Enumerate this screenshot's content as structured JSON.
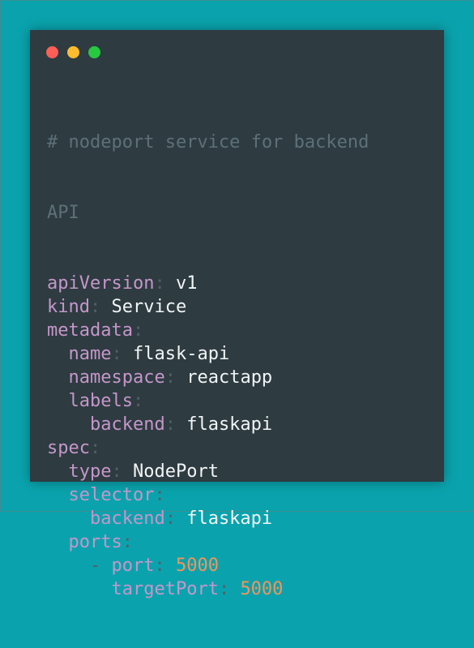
{
  "colors": {
    "background": "#0aa3ad",
    "window": "#2e3b41",
    "close": "#ff5f57",
    "minimize": "#febc2e",
    "maximize": "#28c840",
    "comment": "#5d7078",
    "key": "#c497c9",
    "punctuation": "#4f6068",
    "value": "#f2f5f6",
    "number": "#f0955b"
  },
  "window": {
    "controls": [
      "close-dot",
      "minimize-dot",
      "maximize-dot"
    ]
  },
  "code": {
    "comment_line1": "# nodeport service for backend",
    "comment_line2": "API",
    "lines": [
      {
        "indent": "",
        "key": "apiVersion",
        "value": "v1",
        "type": "text"
      },
      {
        "indent": "",
        "key": "kind",
        "value": "Service",
        "type": "text"
      },
      {
        "indent": "",
        "key": "metadata",
        "value": "",
        "type": "text"
      },
      {
        "indent": "  ",
        "key": "name",
        "value": "flask-api",
        "type": "text"
      },
      {
        "indent": "  ",
        "key": "namespace",
        "value": "reactapp",
        "type": "text"
      },
      {
        "indent": "  ",
        "key": "labels",
        "value": "",
        "type": "text"
      },
      {
        "indent": "    ",
        "key": "backend",
        "value": "flaskapi",
        "type": "text"
      },
      {
        "indent": "",
        "key": "spec",
        "value": "",
        "type": "text"
      },
      {
        "indent": "  ",
        "key": "type",
        "value": "NodePort",
        "type": "text"
      },
      {
        "indent": "  ",
        "key": "selector",
        "value": "",
        "type": "text"
      },
      {
        "indent": "    ",
        "key": "backend",
        "value": "flaskapi",
        "type": "text"
      },
      {
        "indent": "  ",
        "key": "ports",
        "value": "",
        "type": "text"
      },
      {
        "indent": "    ",
        "dash": "- ",
        "key": "port",
        "value": "5000",
        "type": "number"
      },
      {
        "indent": "      ",
        "key": "targetPort",
        "value": "5000",
        "type": "number"
      }
    ]
  }
}
